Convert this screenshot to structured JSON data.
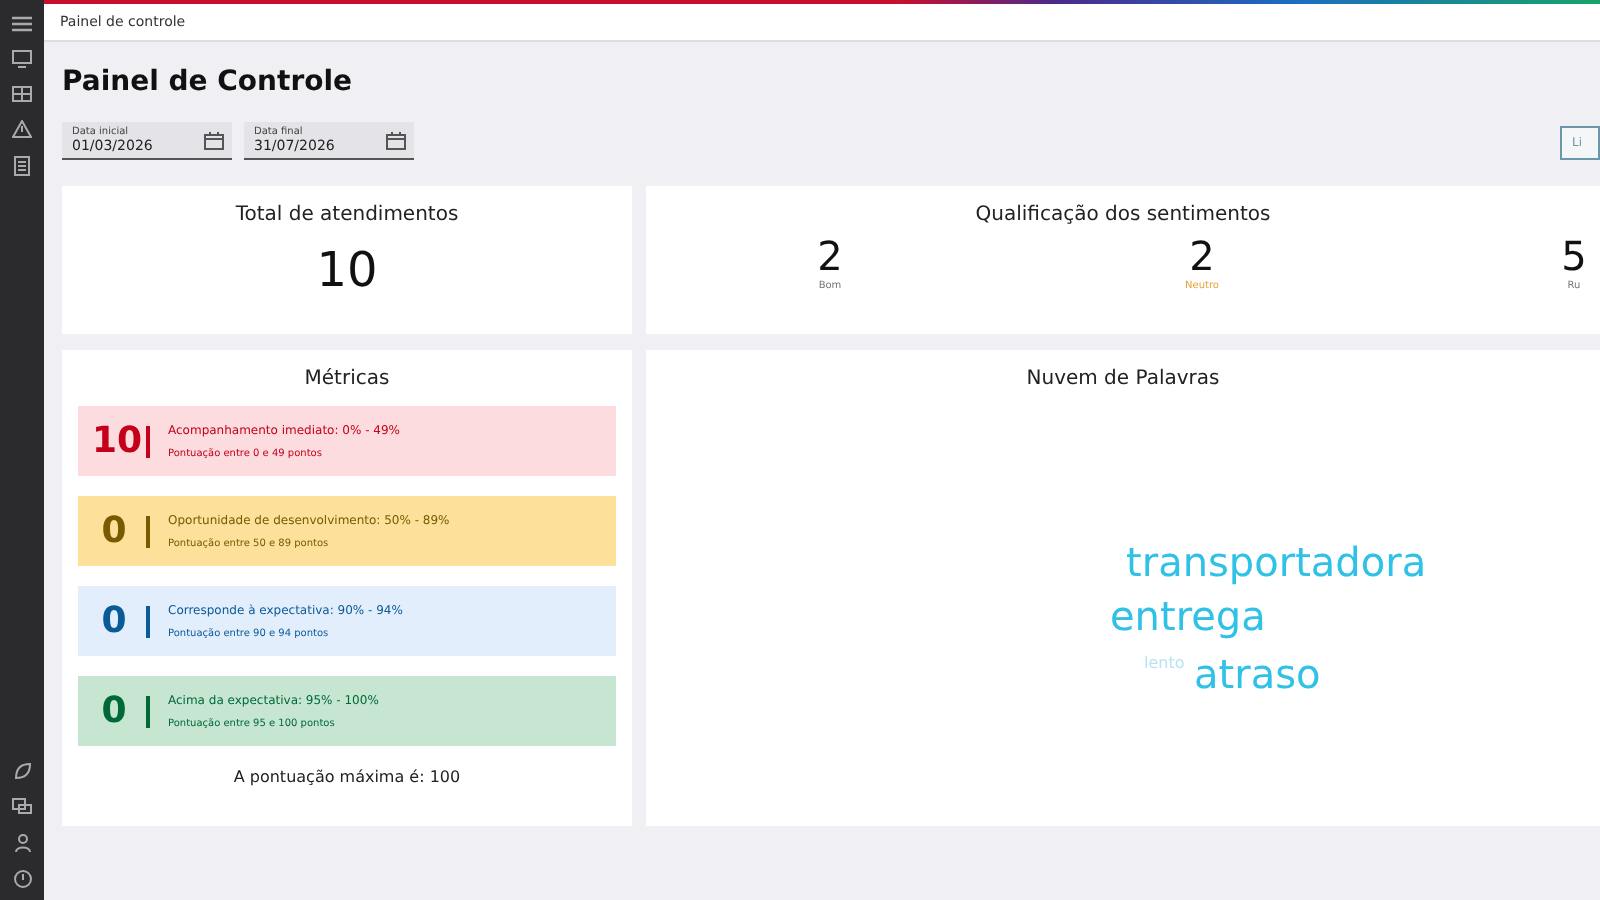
{
  "breadcrumb": "Painel de controle",
  "title": "Painel de Controle",
  "date_fields": [
    {
      "label": "Data inicial",
      "value": "01/03/2026"
    },
    {
      "label": "Data final",
      "value": "31/07/2026"
    }
  ],
  "clear_button": "Li",
  "total_card": {
    "title": "Total de atendimentos",
    "value": "10"
  },
  "sentiment_card": {
    "title": "Qualificação dos sentimentos",
    "items": [
      {
        "value": "2",
        "label": "Bom",
        "color": "#777777"
      },
      {
        "value": "2",
        "label": "Neutro",
        "color": "#e8a33a"
      },
      {
        "value": "5",
        "label": "Ru",
        "color": "#777777"
      }
    ]
  },
  "metrics_card": {
    "title": "Métricas",
    "items": [
      {
        "kind": "urgent",
        "count": "10",
        "title": "Acompanhamento imediato: 0% - 49%",
        "subtitle": "Pontuação entre 0 e 49 pontos"
      },
      {
        "kind": "opportunity",
        "count": "0",
        "title": "Oportunidade de desenvolvimento: 50% - 89%",
        "subtitle": "Pontuação entre 50 e 89 pontos"
      },
      {
        "kind": "meets",
        "count": "0",
        "title": "Corresponde à expectativa: 90% - 94%",
        "subtitle": "Pontuação entre 90 e 94 pontos"
      },
      {
        "kind": "exceeds",
        "count": "0",
        "title": "Acima da expectativa: 95% - 100%",
        "subtitle": "Pontuação entre 95 e 100 pontos"
      }
    ],
    "footer": "A pontuação máxima é: 100"
  },
  "word_cloud_card": {
    "title": "Nuvem de Palavras",
    "words": [
      {
        "text": "transportadora",
        "kind": "large"
      },
      {
        "text": "entrega",
        "kind": "large"
      },
      {
        "text": "atraso",
        "kind": "large"
      },
      {
        "text": "lento",
        "kind": "faint"
      }
    ]
  }
}
